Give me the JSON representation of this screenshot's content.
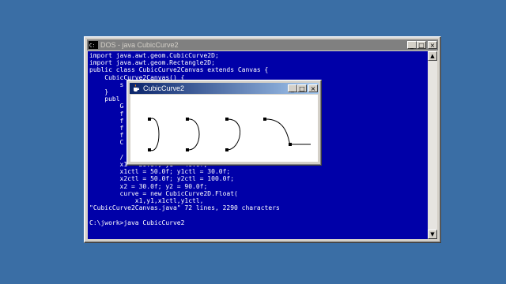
{
  "desktop": {
    "background": "#3a6ea5"
  },
  "dos_window": {
    "title": "DOS - java CubicCurve2",
    "icon": "dos-window-icon",
    "buttons": {
      "minimize": "_",
      "maximize": "□",
      "close": "×"
    },
    "console_lines": [
      "import java.awt.geom.CubicCurve2D;",
      "import java.awt.geom.Rectangle2D;",
      "public class CubicCurve2Canvas extends Canvas {",
      "    CubicCurve2Canvas() {",
      "        s",
      "    }",
      "    publ",
      "        G",
      "        f",
      "        f",
      "        f",
      "        f",
      "        C",
      "",
      "        /",
      "        x1 = 30.0f; y1 = 40.0f;",
      "        x1ctl = 50.0f; y1ctl = 30.0f;",
      "        x2ctl = 50.0f; y2ctl = 100.0f;",
      "        x2 = 30.0f; y2 = 90.0f;",
      "        curve = new CubicCurve2D.Float(",
      "            x1,y1,x1ctl,y1ctl,",
      "\"CubicCurve2Canvas.java\" 72 lines, 2290 characters",
      "",
      "C:\\jwork>java CubicCurve2"
    ],
    "console_bg": "#0000a8",
    "console_fg": "#ffffff"
  },
  "applet_window": {
    "title": "CubicCurve2",
    "icon": "java-cup-icon",
    "buttons": {
      "minimize": "_",
      "maximize": "□",
      "close": "×"
    }
  }
}
